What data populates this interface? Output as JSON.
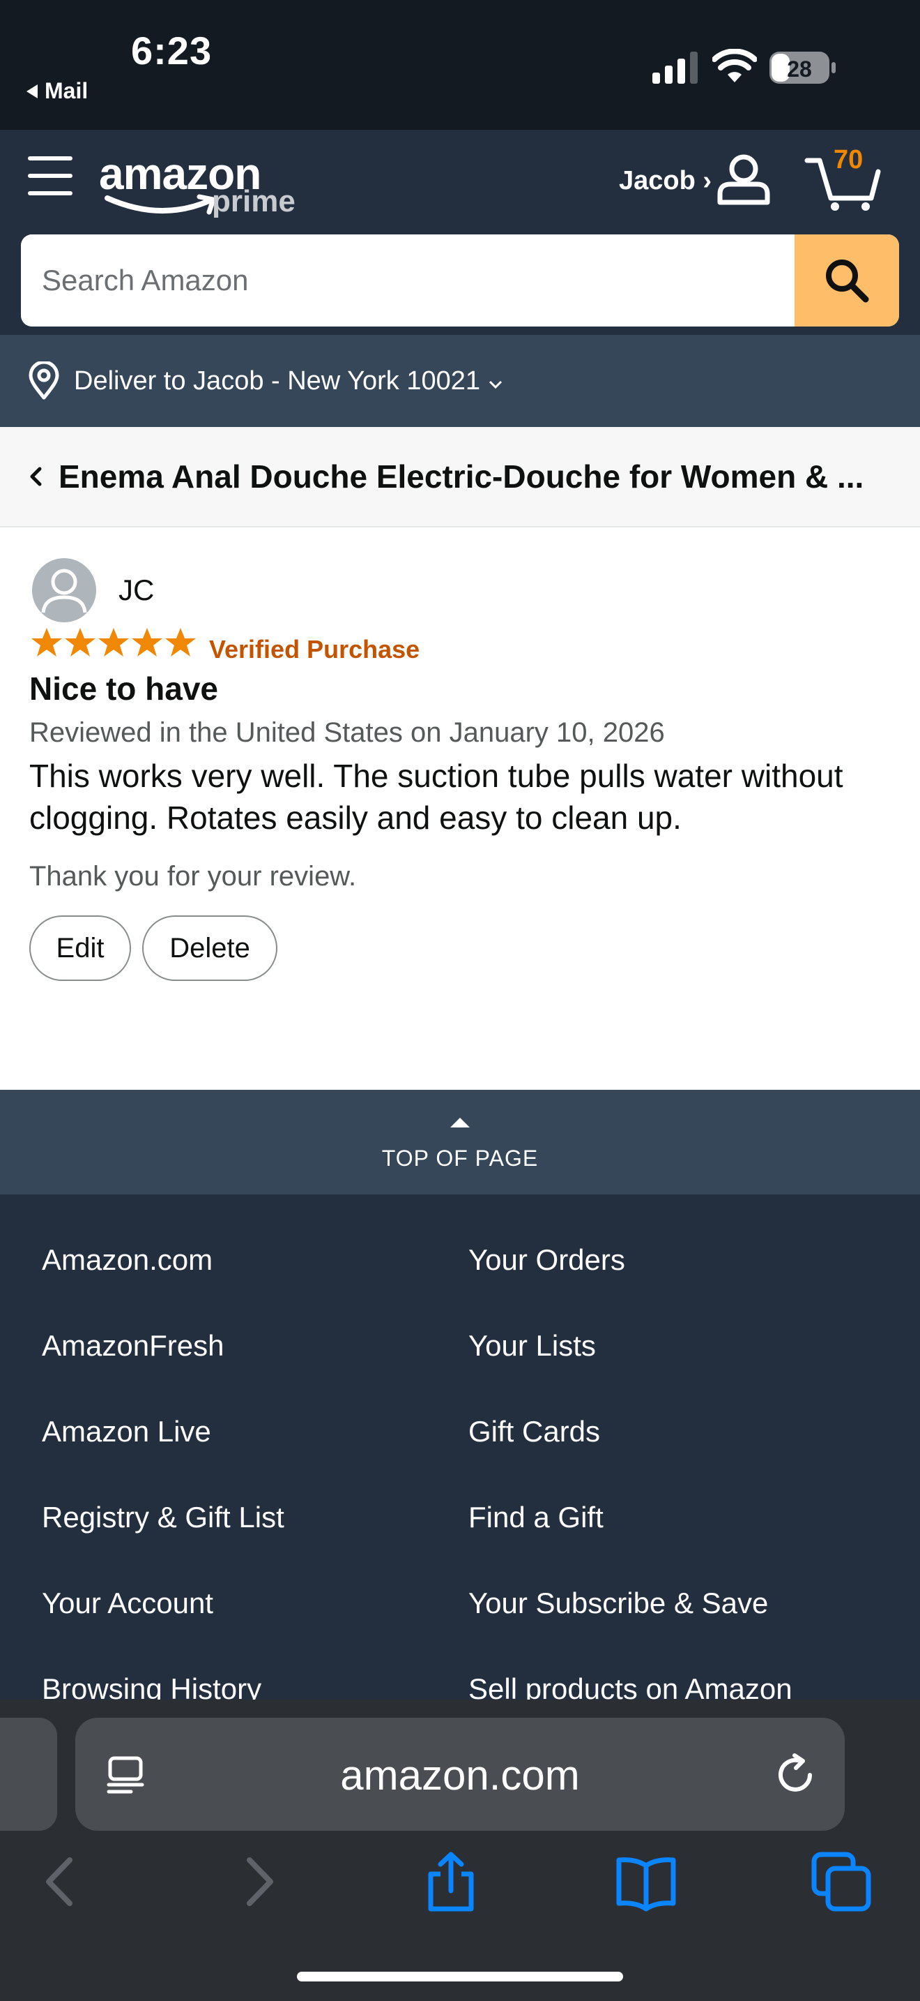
{
  "status_bar": {
    "time": "6:23",
    "back_label": "Mail",
    "battery": "28"
  },
  "header": {
    "logo_text": "amazon",
    "logo_sub": "prime",
    "account_label": "Jacob ›",
    "cart_count": "70",
    "search_placeholder": "Search Amazon"
  },
  "deliver": {
    "text": "Deliver to Jacob - New York 10021"
  },
  "product": {
    "title": "Enema Anal Douche Electric-Douche for Women & ..."
  },
  "review": {
    "reviewer": "JC",
    "rating": 5,
    "verified": "Verified Purchase",
    "title": "Nice to have",
    "date": "Reviewed in the United States on January 10, 2026",
    "body": "This works very well. The suction tube pulls water without clogging. Rotates easily and easy to clean up.",
    "thanks": "Thank you for your review.",
    "edit_label": "Edit",
    "delete_label": "Delete"
  },
  "top_of_page": "TOP OF PAGE",
  "footer": {
    "left": [
      "Amazon.com",
      "AmazonFresh",
      "Amazon Live",
      "Registry & Gift List",
      "Your Account",
      "Browsing History"
    ],
    "right": [
      "Your Orders",
      "Your Lists",
      "Gift Cards",
      "Find a Gift",
      "Your Subscribe & Save",
      "Sell products on Amazon"
    ]
  },
  "safari": {
    "url": "amazon.com"
  },
  "colors": {
    "header": "#232f3e",
    "deliver": "#37475a",
    "search_button": "#febd69",
    "star": "#f08804",
    "verified": "#c45500",
    "safari_blue": "#0a84ff"
  }
}
